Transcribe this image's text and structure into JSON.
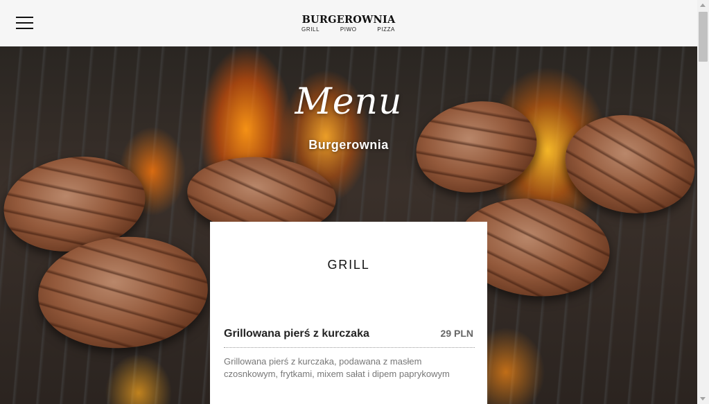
{
  "header": {
    "menu_icon": "hamburger-menu-icon",
    "logo": {
      "name": "BURGEROWNIA",
      "tagline": [
        "GRILL",
        "PIWO",
        "PIZZA"
      ]
    }
  },
  "hero": {
    "title": "Menu",
    "subtitle": "Burgerownia"
  },
  "menu_section": {
    "title": "GRILL",
    "items": [
      {
        "name": "Grillowana pierś z kurczaka",
        "price": "29 PLN",
        "description": "Grillowana pierś z kurczaka, podawana z masłem czosnkowym, frytkami, mixem sałat i dipem paprykowym"
      }
    ]
  },
  "colors": {
    "header_bg": "#f6f6f6",
    "card_bg": "#ffffff",
    "text_dark": "#222222",
    "text_muted": "#777777"
  }
}
